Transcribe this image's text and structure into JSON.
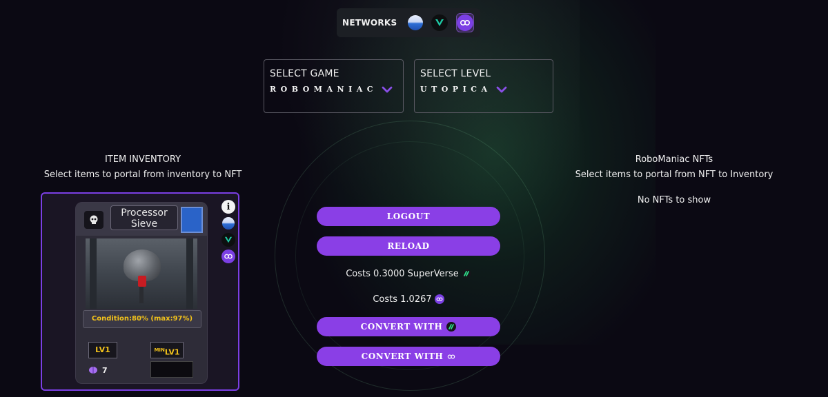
{
  "networks": {
    "label": "NETWORKS",
    "items": [
      {
        "icon": "superverse-network-icon",
        "active": false
      },
      {
        "icon": "v-network-icon",
        "active": false
      },
      {
        "icon": "polygon-network-icon",
        "active": true
      }
    ]
  },
  "select_game": {
    "title": "SELECT GAME",
    "value": "ROBOMANIAC"
  },
  "select_level": {
    "title": "SELECT LEVEL",
    "value": "UTOPICA"
  },
  "inventory": {
    "title": "ITEM INVENTORY",
    "subtitle": "Select items to portal from inventory to NFT",
    "card": {
      "name_line1": "Processor",
      "name_line2": "Sieve",
      "condition": "Condition:80% (max:97%)",
      "level": "LV1",
      "min_prefix": "MIN",
      "min_level": "LV1",
      "gem_count": "7",
      "info_icon_text": "i"
    }
  },
  "nfts": {
    "title": "RoboManiac NFTs",
    "subtitle": "Select items to portal from NFT to Inventory",
    "empty": "No NFTs to show"
  },
  "actions": {
    "logout": "LOGOUT",
    "reload": "RELOAD",
    "cost_superverse": "Costs 0.3000 SuperVerse",
    "cost_polygon": "Costs 1.0267",
    "convert_sv": "CONVERT WITH",
    "convert_poly": "CONVERT WITH"
  },
  "colors": {
    "accent": "#8a3fe6",
    "background": "#0b0913",
    "condition_text": "#f2c21b"
  }
}
